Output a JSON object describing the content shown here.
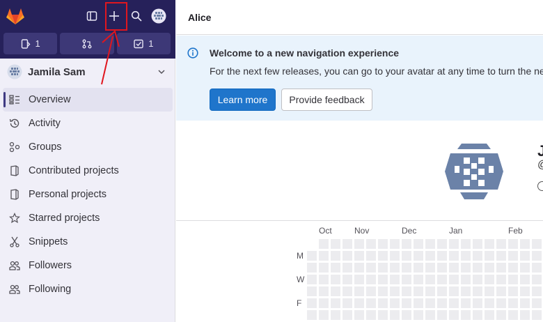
{
  "counters": {
    "issues": "1",
    "todos": "1"
  },
  "user": {
    "name": "Jamila Sam"
  },
  "nav": [
    {
      "label": "Overview",
      "icon": "overview-icon",
      "active": true
    },
    {
      "label": "Activity",
      "icon": "history-icon"
    },
    {
      "label": "Groups",
      "icon": "group-icon"
    },
    {
      "label": "Contributed projects",
      "icon": "project-icon"
    },
    {
      "label": "Personal projects",
      "icon": "project-icon"
    },
    {
      "label": "Starred projects",
      "icon": "star-icon"
    },
    {
      "label": "Snippets",
      "icon": "snippet-icon"
    },
    {
      "label": "Followers",
      "icon": "users-icon"
    },
    {
      "label": "Following",
      "icon": "users-icon"
    }
  ],
  "header": {
    "title": "Alice"
  },
  "banner": {
    "title": "Welcome to a new navigation experience",
    "text": "For the next few releases, you can go to your avatar at any time to turn the new",
    "learn_more": "Learn more",
    "feedback": "Provide feedback"
  },
  "profile": {
    "initial": "J",
    "at": "@"
  },
  "calendar": {
    "months": [
      "Oct",
      "Nov",
      "Dec",
      "Jan",
      "Feb"
    ],
    "days": [
      "M",
      "W",
      "F"
    ]
  },
  "colors": {
    "topbar": "#26215a",
    "sidebar": "#f0eff8",
    "primary_button": "#1f75cb",
    "annotation": "#e0161e"
  }
}
